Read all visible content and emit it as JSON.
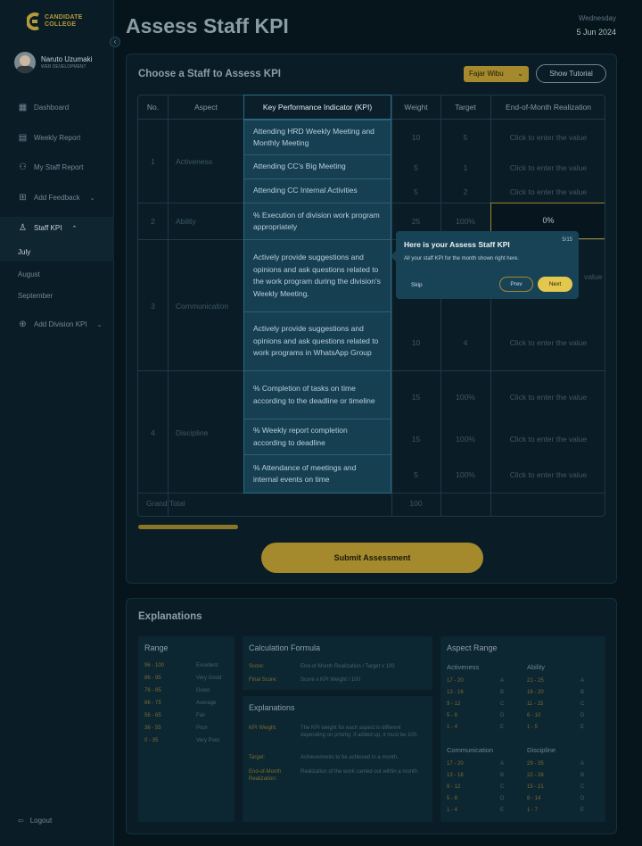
{
  "brand": {
    "line1": "CANDIDATE",
    "line2": "COLLEGE",
    "color": "#b59a3c"
  },
  "profile": {
    "name": "Naruto Uzumaki",
    "role": "WEB DEVELOPMENT"
  },
  "nav": {
    "dashboard": "Dashboard",
    "weekly_report": "Weekly Report",
    "my_staff_report": "My Staff Report",
    "add_feedback": "Add Feedback",
    "staff_kpi": "Staff KPI",
    "months": [
      "July",
      "August",
      "September"
    ],
    "add_division_kpi": "Add Division KPI",
    "logout": "Logout"
  },
  "header": {
    "title": "Assess Staff KPI",
    "day": "Wednesday",
    "date": "5 Jun 2024"
  },
  "card": {
    "title": "Choose a  Staff to Assess KPI",
    "staff": "Fajar Wibu",
    "tutorial": "Show Tutorial"
  },
  "table": {
    "headers": [
      "No.",
      "Aspect",
      "Key Performance Indicator (KPI)",
      "Weight",
      "Target",
      "End-of-Month Realization"
    ],
    "aspects": [
      {
        "no": "1",
        "name": "Activeness"
      },
      {
        "no": "2",
        "name": "Ability"
      },
      {
        "no": "3",
        "name": "Communication"
      },
      {
        "no": "4",
        "name": "Discipline"
      }
    ],
    "rows": [
      {
        "kpi": "Attending HRD Weekly Meeting and Monthly Meeting",
        "weight": "10",
        "target": "5",
        "realization": "Click to enter the value"
      },
      {
        "kpi": "Attending CC's Big Meeting",
        "weight": "5",
        "target": "1",
        "realization": "Click to enter the value"
      },
      {
        "kpi": "Attending CC Internal Activities",
        "weight": "5",
        "target": "2",
        "realization": "Click to enter the value"
      },
      {
        "kpi": "% Execution of division work program appropriately",
        "weight": "25",
        "target": "100%",
        "realization": "0%"
      },
      {
        "kpi": "Actively provide suggestions and opinions and ask questions related to the work program during the division's Weekly Meeting.",
        "weight": "",
        "target": "",
        "realization": "value"
      },
      {
        "kpi": "Actively provide suggestions and opinions and ask questions related to work programs in WhatsApp Group",
        "weight": "10",
        "target": "4",
        "realization": "Click to enter the value"
      },
      {
        "kpi": "% Completion of tasks on time according to the deadline or timeline",
        "weight": "15",
        "target": "100%",
        "realization": "Click to enter the value"
      },
      {
        "kpi": "% Weekly report completion according to deadline",
        "weight": "15",
        "target": "100%",
        "realization": "Click to enter the value"
      },
      {
        "kpi": "% Attendance of meetings and internal events on time",
        "weight": "5",
        "target": "100%",
        "realization": "Click to enter the value"
      }
    ],
    "grand_total_label": "Grand Total",
    "grand_total_weight": "100"
  },
  "submit": "Submit Assessment",
  "tutorial_popover": {
    "title": "Here is your Assess Staff KPI",
    "step": "5/15",
    "description": "All your staff KPI for the month shown right here.",
    "skip": "Skip",
    "prev": "Prev",
    "next": "Next"
  },
  "explanations": {
    "title": "Explanations",
    "range": {
      "title": "Range",
      "rows": [
        [
          "96 - 100",
          "Excellent"
        ],
        [
          "86 - 95",
          "Very Good"
        ],
        [
          "76 - 85",
          "Good"
        ],
        [
          "66 - 75",
          "Average"
        ],
        [
          "56 - 65",
          "Fair"
        ],
        [
          "36 - 55",
          "Poor"
        ],
        [
          "0 - 35",
          "Very Poor"
        ]
      ]
    },
    "formula": {
      "title": "Calculation Formula",
      "rows": [
        [
          "Score:",
          "End-of-Month Realization / Target x 100"
        ],
        [
          "Final Score:",
          "Score x KPI Weight / 100"
        ]
      ]
    },
    "explain": {
      "title": "Explanations",
      "rows": [
        [
          "KPI Weight:",
          "The KPI weight for each aspect is different depending on priority; if added up, it must be 100."
        ],
        [
          "Target:",
          "Achievements to be achieved in a month."
        ],
        [
          "End-of-Month Realization:",
          "Realization of the work carried out within a month."
        ]
      ]
    },
    "aspect_range": {
      "title": "Aspect Range",
      "groups": [
        {
          "name": "Activeness",
          "rows": [
            [
              "17 - 20",
              "A"
            ],
            [
              "13 - 16",
              "B"
            ],
            [
              "9 - 12",
              "C"
            ],
            [
              "5 - 8",
              "D"
            ],
            [
              "1 - 4",
              "E"
            ]
          ]
        },
        {
          "name": "Ability",
          "rows": [
            [
              "21 - 25",
              "A"
            ],
            [
              "16 - 20",
              "B"
            ],
            [
              "11 - 15",
              "C"
            ],
            [
              "6 - 10",
              "D"
            ],
            [
              "1 - 5",
              "E"
            ]
          ]
        },
        {
          "name": "Communication",
          "rows": [
            [
              "17 - 20",
              "A"
            ],
            [
              "13 - 16",
              "B"
            ],
            [
              "9 - 12",
              "C"
            ],
            [
              "5 - 8",
              "D"
            ],
            [
              "1 - 4",
              "E"
            ]
          ]
        },
        {
          "name": "Discipline",
          "rows": [
            [
              "29 - 35",
              "A"
            ],
            [
              "22 - 28",
              "B"
            ],
            [
              "15 - 21",
              "C"
            ],
            [
              "8 - 14",
              "D"
            ],
            [
              "1 - 7",
              "E"
            ]
          ]
        }
      ]
    }
  },
  "colors": {
    "accent": "#a48a2c",
    "background": "#06141c",
    "kpi_highlight": "#173f52"
  }
}
